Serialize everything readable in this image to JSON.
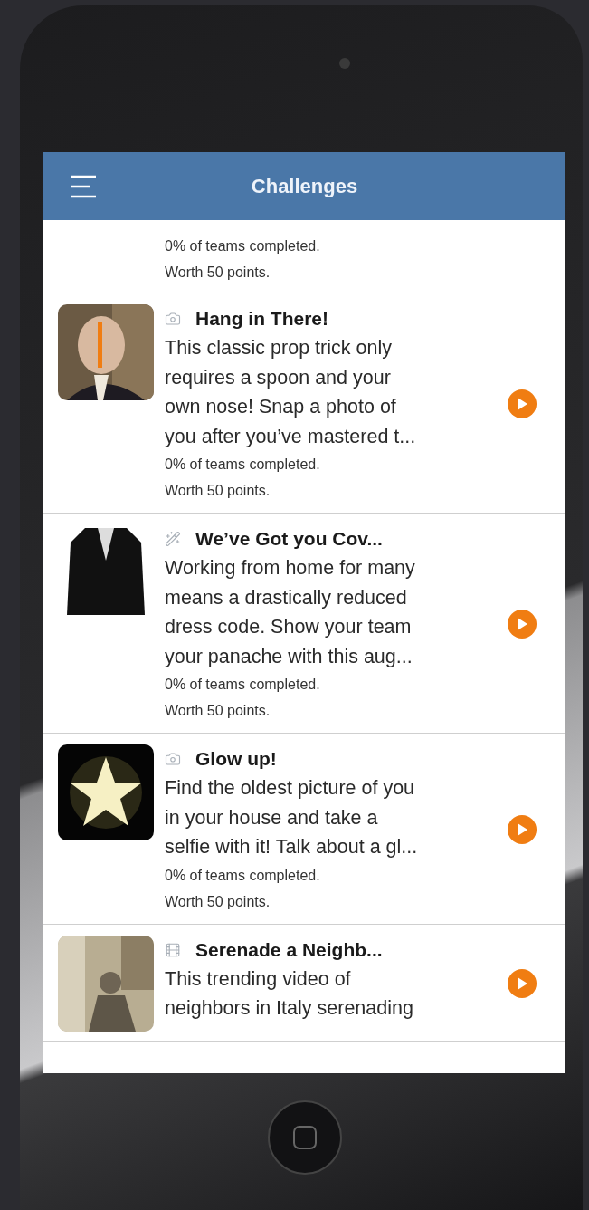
{
  "header": {
    "title": "Challenges"
  },
  "challenges": [
    {
      "stats": [
        "0% of teams completed.",
        "Worth 50 points."
      ]
    },
    {
      "thumb": {
        "kind": "portrait"
      },
      "category": {
        "kind": "camera"
      },
      "title": "Hang in There!",
      "description": "This classic prop trick only\nrequires a spoon and your\nown nose! Snap a photo of\nyou after you’ve mastered t...",
      "stats": [
        "0% of teams completed.",
        "Worth 50 points."
      ]
    },
    {
      "thumb": {
        "kind": "jacket"
      },
      "category": {
        "kind": "wand"
      },
      "title": "We’ve Got you Cov...",
      "description": "Working from home for many\nmeans a drastically reduced\ndress code. Show your team\nyour panache with this aug...",
      "stats": [
        "0% of teams completed.",
        "Worth 50 points."
      ]
    },
    {
      "thumb": {
        "kind": "star"
      },
      "category": {
        "kind": "camera"
      },
      "title": "Glow up!",
      "description": "Find the oldest picture of you\nin your house and take a\nselfie with it! Talk about a gl...",
      "stats": [
        "0% of teams completed.",
        "Worth 50 points."
      ]
    },
    {
      "thumb": {
        "kind": "street"
      },
      "category": {
        "kind": "film"
      },
      "title": "Serenade a Neighb...",
      "description": "This trending video of\nneighbors in Italy serenading"
    }
  ]
}
